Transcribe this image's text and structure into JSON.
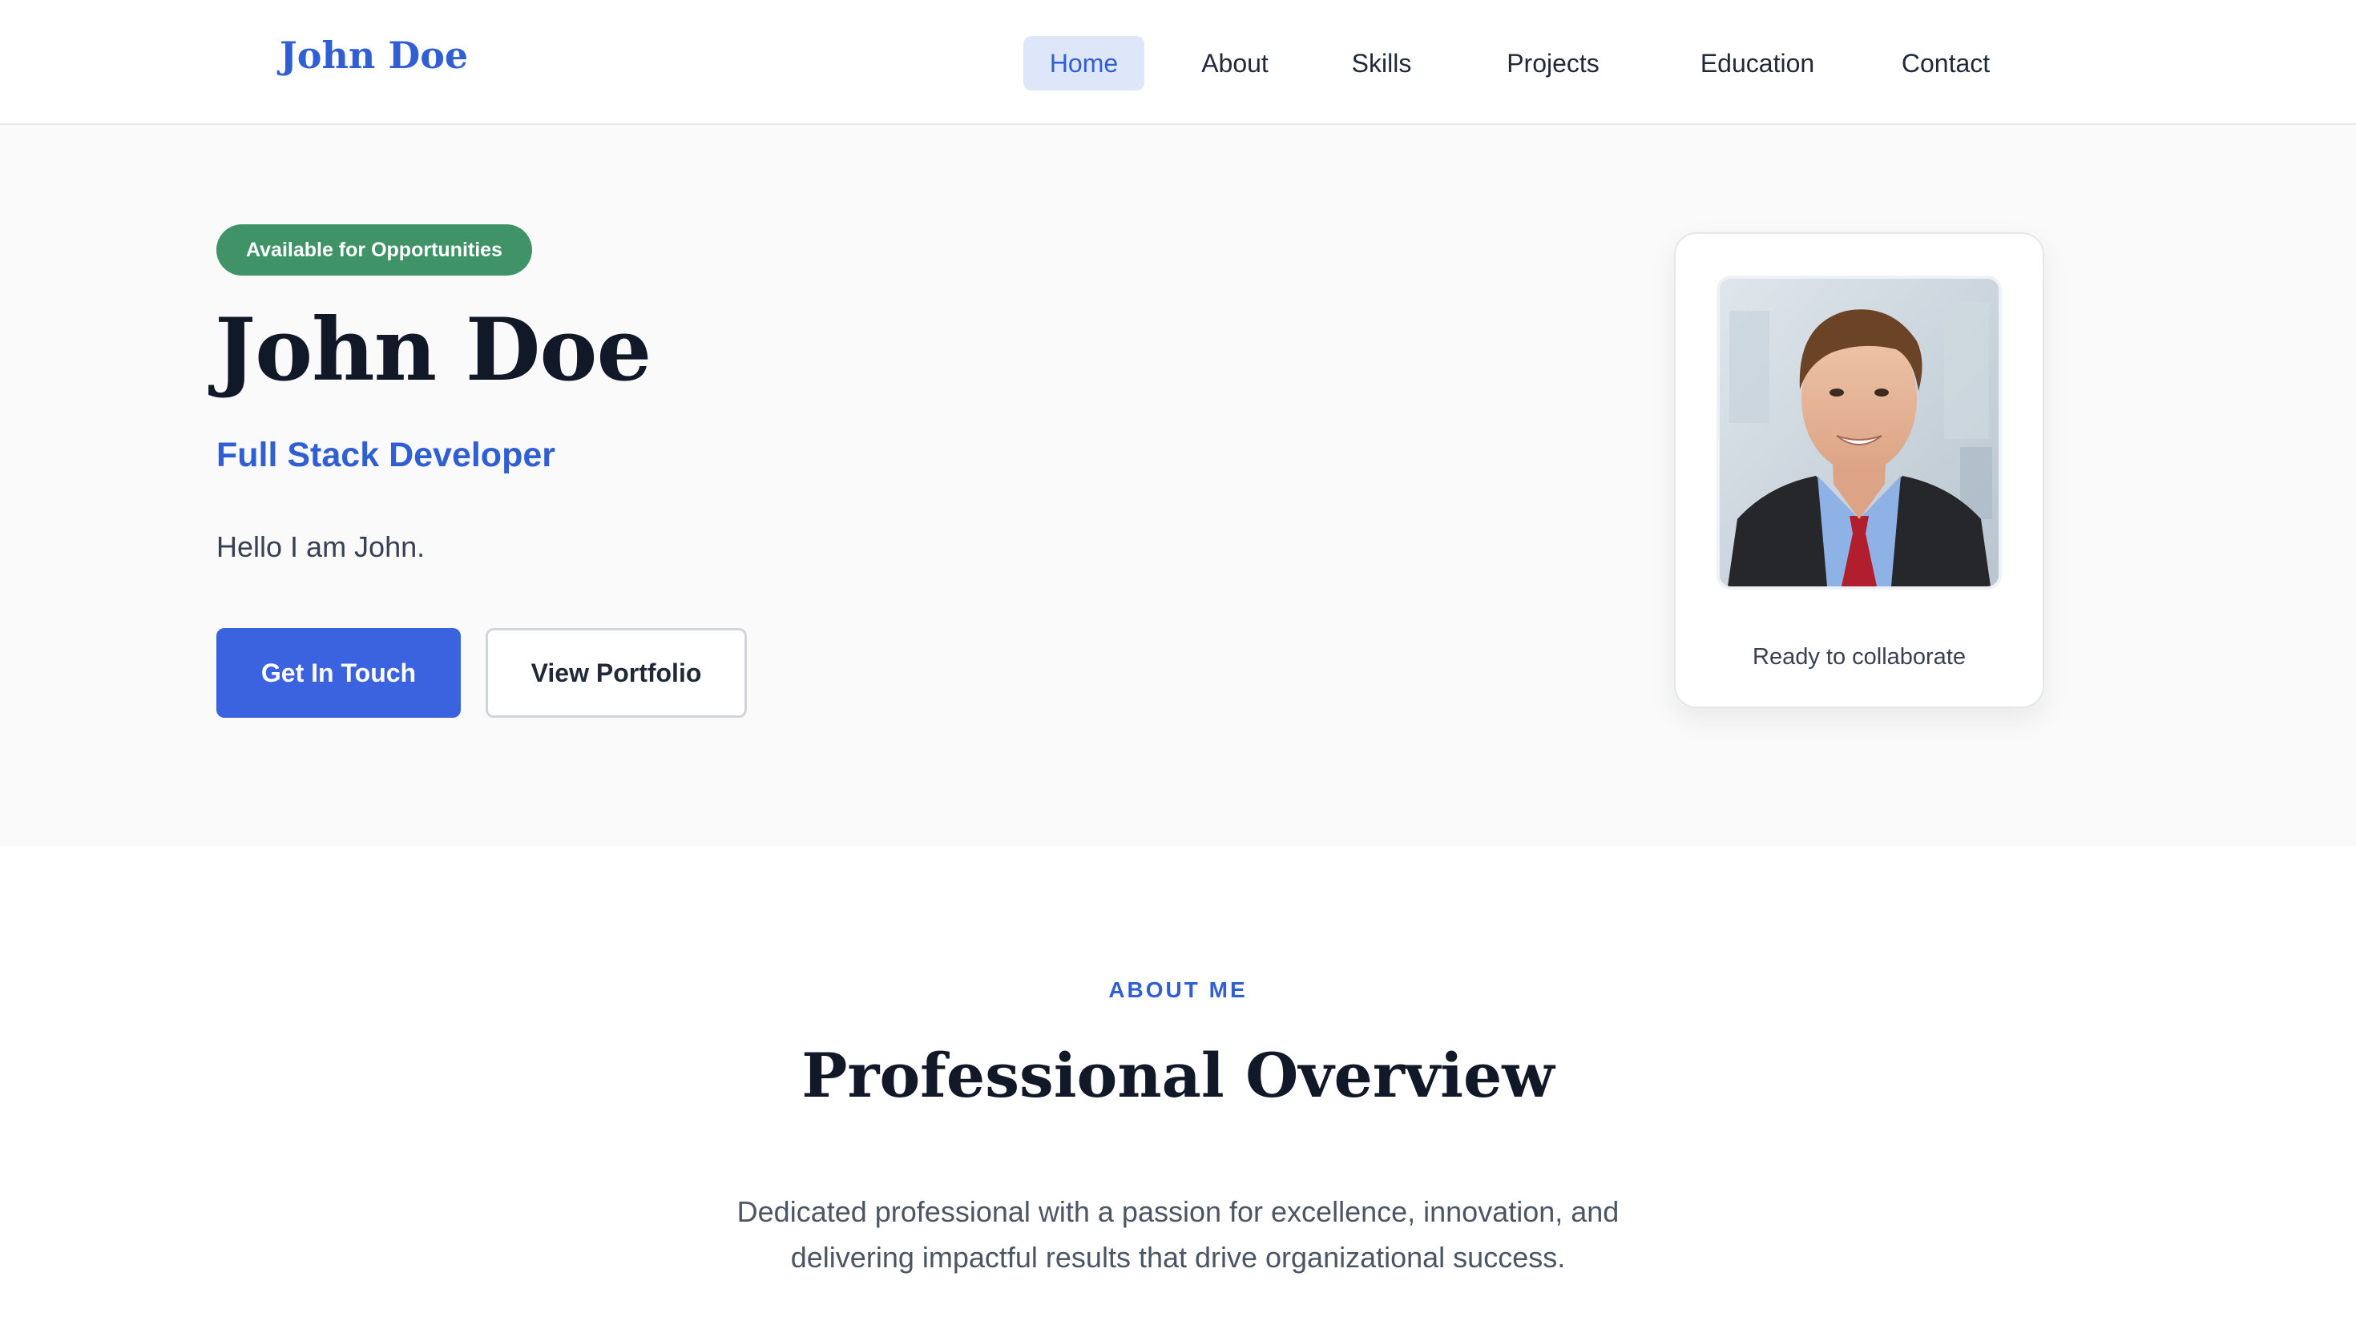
{
  "header": {
    "logo": "John Doe",
    "nav": [
      {
        "label": "Home",
        "active": true
      },
      {
        "label": "About",
        "active": false
      },
      {
        "label": "Skills",
        "active": false
      },
      {
        "label": "Projects",
        "active": false
      },
      {
        "label": "Education",
        "active": false
      },
      {
        "label": "Contact",
        "active": false
      }
    ]
  },
  "hero": {
    "badge": "Available for Opportunities",
    "name": "John Doe",
    "role": "Full Stack Developer",
    "intro": "Hello I am John.",
    "primary_button": "Get In Touch",
    "secondary_button": "View Portfolio",
    "card_caption": "Ready to collaborate"
  },
  "about": {
    "label": "ABOUT ME",
    "title": "Professional Overview",
    "description": "Dedicated professional with a passion for excellence, innovation, and delivering impactful results that drive organizational success."
  },
  "colors": {
    "brand_blue": "#2f5fd3",
    "primary_button": "#3b63e0",
    "badge_green": "#3f9367",
    "active_nav_bg": "#dde7f9",
    "hero_bg": "#fafafa"
  }
}
